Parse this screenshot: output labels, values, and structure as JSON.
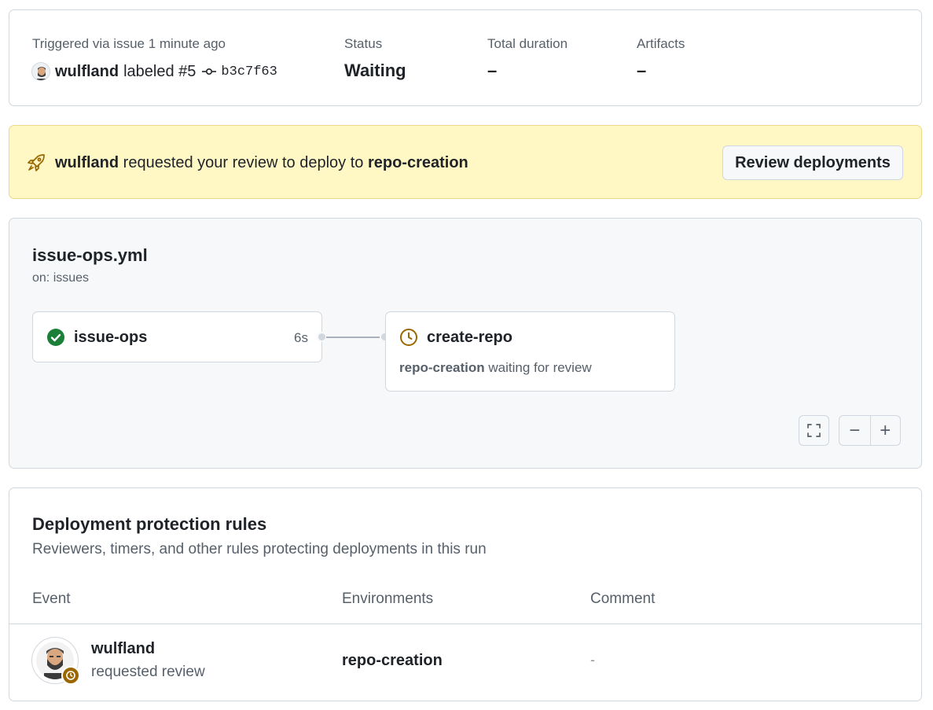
{
  "summary": {
    "trigger_label": "Triggered via issue 1 minute ago",
    "actor": "wulfland",
    "action": "labeled #5",
    "commit_sha": "b3c7f63",
    "status_label": "Status",
    "status_value": "Waiting",
    "duration_label": "Total duration",
    "duration_value": "–",
    "artifacts_label": "Artifacts",
    "artifacts_value": "–"
  },
  "banner": {
    "icon": "rocket-icon",
    "user": "wulfland",
    "text_middle": " requested your review to deploy to ",
    "environment": "repo-creation",
    "button_label": "Review deployments",
    "color_bg": "#fff8c5"
  },
  "workflow": {
    "file": "issue-ops.yml",
    "trigger": "on: issues",
    "jobs": [
      {
        "name": "issue-ops",
        "duration": "6s",
        "status": "success",
        "icon": "check-circle-icon"
      },
      {
        "name": "create-repo",
        "environment": "repo-creation",
        "status_text": " waiting for review",
        "status": "waiting",
        "icon": "clock-icon"
      }
    ],
    "controls": {
      "fullscreen_icon": "fullscreen-icon",
      "zoom_out": "−",
      "zoom_in": "+"
    }
  },
  "protection_rules": {
    "title": "Deployment protection rules",
    "description": "Reviewers, timers, and other rules protecting deployments in this run",
    "columns": [
      "Event",
      "Environments",
      "Comment"
    ],
    "rows": [
      {
        "user": "wulfland",
        "action": "requested review",
        "environment": "repo-creation",
        "comment": "-"
      }
    ]
  },
  "colors": {
    "success": "#1a7f37",
    "waiting": "#9a6700",
    "muted": "#57606a",
    "border": "#d0d7de"
  }
}
